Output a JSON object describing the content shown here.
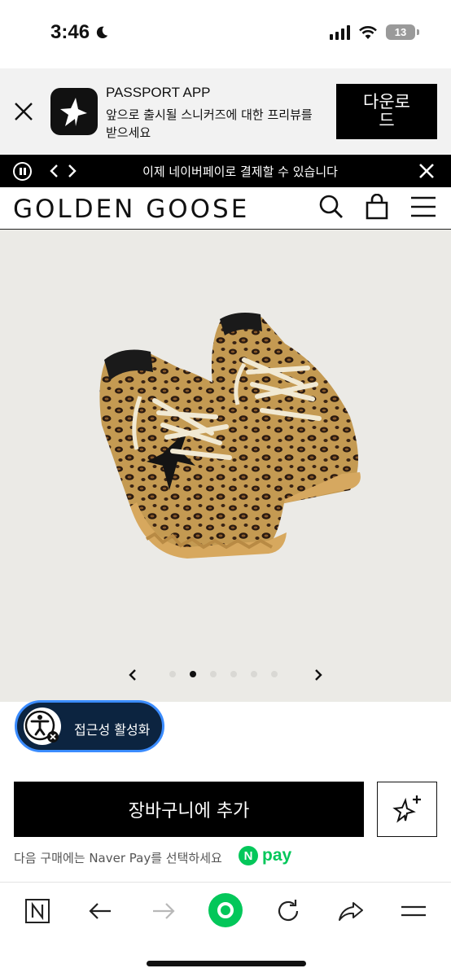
{
  "status_bar": {
    "time": "3:46",
    "battery_level": "13",
    "icons": [
      "moon-icon",
      "cellular-signal-icon",
      "wifi-icon",
      "battery-icon"
    ]
  },
  "app_banner": {
    "title": "PASSPORT APP",
    "description": "앞으로 출시될 스니커즈에 대한 프리뷰를 받으세요",
    "download_label": "다운로드"
  },
  "promo_bar": {
    "message": "이제 네이버페이로 결제할 수 있습니다"
  },
  "header": {
    "logo": "GOLDEN GOOSE",
    "icons": [
      "search-icon",
      "shopping-bag-icon",
      "menu-icon"
    ]
  },
  "carousel": {
    "total_slides": 6,
    "active_index": 1
  },
  "accessibility": {
    "label": "접근성 활성화"
  },
  "cta": {
    "add_to_cart_label": "장바구니에 추가",
    "naver_text": "다음 구매에는 Naver Pay를 선택하세요",
    "npay_n": "N",
    "npay_pay": "pay"
  },
  "colors": {
    "accent_blue": "#3b8cff",
    "naver_green": "#03c75a",
    "toolbar_green": "#03c75a"
  },
  "toolbar": {
    "icons": [
      "naver-n-icon",
      "back-arrow-icon",
      "forward-arrow-icon",
      "home-circle-icon",
      "reload-icon",
      "share-icon",
      "menu-icon"
    ]
  }
}
